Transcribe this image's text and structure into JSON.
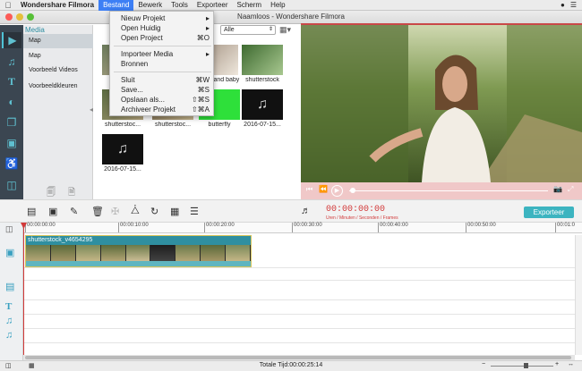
{
  "menubar": {
    "apple": "",
    "app_name": "Wondershare Filmora",
    "items": [
      "Bestand",
      "Bewerk",
      "Tools",
      "Exporteer",
      "Scherm",
      "Help"
    ],
    "open_menu": "Bestand"
  },
  "window": {
    "title": "Naamloos - Wondershare Filmora"
  },
  "file_menu": {
    "items": [
      {
        "label": "Nieuw Projekt",
        "shortcut": "▸"
      },
      {
        "label": "Open Huidig",
        "shortcut": "▸"
      },
      {
        "label": "Open Project",
        "shortcut": "⌘O"
      },
      {
        "label": "Importeer Media",
        "shortcut": "▸"
      },
      {
        "label": "Bronnen",
        "shortcut": ""
      },
      {
        "label": "Sluit",
        "shortcut": "⌘W"
      },
      {
        "label": "Save...",
        "shortcut": "⌘S"
      },
      {
        "label": "Opslaan als...",
        "shortcut": "⇧⌘S"
      },
      {
        "label": "Archiveer Projekt",
        "shortcut": "⇧⌘A"
      }
    ]
  },
  "media_sidebar": {
    "header": "Media",
    "items": [
      "Map",
      "Map",
      "Voorbeeld Videos",
      "Voorbeeldkleuren"
    ]
  },
  "media_filter": {
    "value": "Alle"
  },
  "media_items": [
    {
      "label": "sh",
      "kind": "video"
    },
    {
      "label": "sh",
      "kind": "video"
    },
    {
      "label": "...and baby",
      "kind": "video"
    },
    {
      "label": "shutterstock",
      "kind": "video"
    },
    {
      "label": "shutterstoc...",
      "kind": "video"
    },
    {
      "label": "shutterstoc...",
      "kind": "video"
    },
    {
      "label": "butterfly",
      "kind": "green"
    },
    {
      "label": "2016-07-15...",
      "kind": "audio"
    },
    {
      "label": "2016-07-15...",
      "kind": "audio"
    }
  ],
  "timecode": {
    "value": "00:00:00:00",
    "units": "Uren / Minuten / Seconden / Frames"
  },
  "export_button": "Exporteer",
  "ruler_ticks": [
    "00:00:00:00",
    "00:00:10:00",
    "00:00:20:00",
    "00:00:30:00",
    "00:00:40:00",
    "00:00:50:00",
    "00:01:0"
  ],
  "clip": {
    "name": "shutterstock_v4654295"
  },
  "status": {
    "total_time": "Totale Tijd:00:00:25:14"
  },
  "colors": {
    "accent": "#3cb4c0",
    "timecode": "#d23a3a",
    "menu_highlight": "#3d7ff5"
  }
}
